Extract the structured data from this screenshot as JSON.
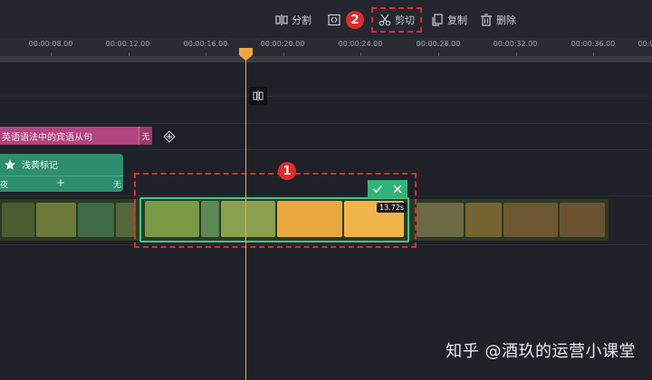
{
  "toolbar": {
    "split_label": "分割",
    "cut_label": "剪切",
    "copy_label": "复制",
    "delete_label": "删除"
  },
  "annotations": {
    "badge_1": "1",
    "badge_2": "2"
  },
  "ruler": {
    "ticks": [
      "00:00:08.00",
      "00:00:12.00",
      "00:00:16.00",
      "00:00:20.00",
      "00:00:24.00",
      "00:00:28.00",
      "00:00:32.00",
      "00:00:36.00",
      "00:00"
    ]
  },
  "tracks": {
    "caption_clip": {
      "label": "英语语法中的宾语从句",
      "end_label": "无"
    },
    "sticker_clip": {
      "label": "浅黄标记",
      "left_label": "夜",
      "mid_label": "+",
      "right_label": "无"
    }
  },
  "selection": {
    "duration": "13.72s"
  },
  "watermark": "知乎 @酒玖的运营小课堂",
  "colors": {
    "accent": "#f2a63b",
    "selection": "#3cc98a",
    "annotation": "#e02b2b"
  }
}
